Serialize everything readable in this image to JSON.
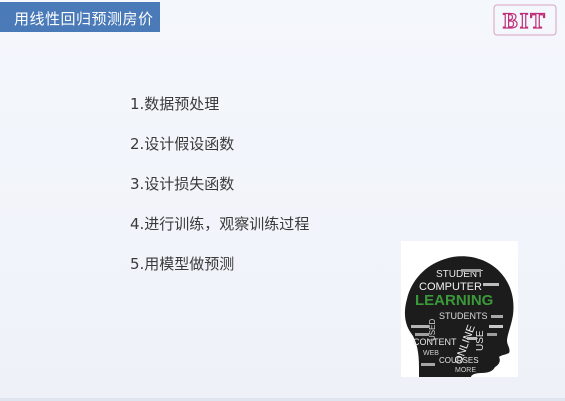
{
  "slide": {
    "title": "用线性回归预测房价",
    "logo_text": "BIT",
    "steps": [
      "1.数据预处理",
      "2.设计假设函数",
      "3.设计损失函数",
      "4.进行训练，观察训练过程",
      "5.用模型做预测"
    ],
    "word_cloud": {
      "words": [
        "STUDENT",
        "COMPUTER",
        "LEARNING",
        "STUDENTS",
        "ONLINE",
        "USE",
        "CONTENT",
        "WEB",
        "COURSES",
        "MORE",
        "USED"
      ],
      "accent_word_color": "#3a9a3a"
    }
  },
  "colors": {
    "title_bar": "#4a7ab8",
    "logo": "#c0307a",
    "background": "#f3f6fb"
  }
}
